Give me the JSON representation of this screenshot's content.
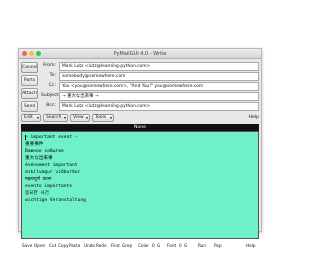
{
  "window": {
    "title": "PyMailGUI 4.0 - Write"
  },
  "sidebar": {
    "buttons": [
      {
        "label": "Cancel"
      },
      {
        "label": "Parts"
      },
      {
        "label": "Attach"
      },
      {
        "label": "Send"
      }
    ]
  },
  "headers": [
    {
      "label": "From:",
      "value": "Mark Lutz <lutz@learning-python.com>"
    },
    {
      "label": "To:",
      "value": "somebody@somewhere.com"
    },
    {
      "label": "Cc:",
      "value": "You <you@somewhere.com>, \"And You!\" you@somewhere.com"
    },
    {
      "label": "Subject:",
      "value": "➝ 重大な出来事 ➝"
    },
    {
      "label": "Bcc:",
      "value": "Mark Lutz <lutz@learning-python.com>"
    }
  ],
  "toolbar": {
    "buttons": [
      {
        "label": "Edit"
      },
      {
        "label": "Search"
      },
      {
        "label": "View"
      },
      {
        "label": "Tools"
      }
    ],
    "arrow": "▾",
    "help": "Help"
  },
  "editor": {
    "header": "None",
    "lines": [
      "➝ important event ➝",
      "重要事件",
      "Важное событие",
      "重大な出来事",
      "événement important",
      "mikilvægur viðburður",
      "महत्वपूर्ण घटना",
      "evento importante",
      "중요한 사건",
      "wichtige Veranstaltung"
    ],
    "background": "#6ff0c8"
  },
  "statusbar": {
    "items": [
      "Save",
      "Open",
      "Cut",
      "Copy",
      "Paste",
      "Undo",
      "Redo",
      "Find",
      "Grep",
      "Color",
      "0",
      "G",
      "Font",
      "0",
      "G",
      "Run",
      "Pop",
      "Help"
    ]
  }
}
